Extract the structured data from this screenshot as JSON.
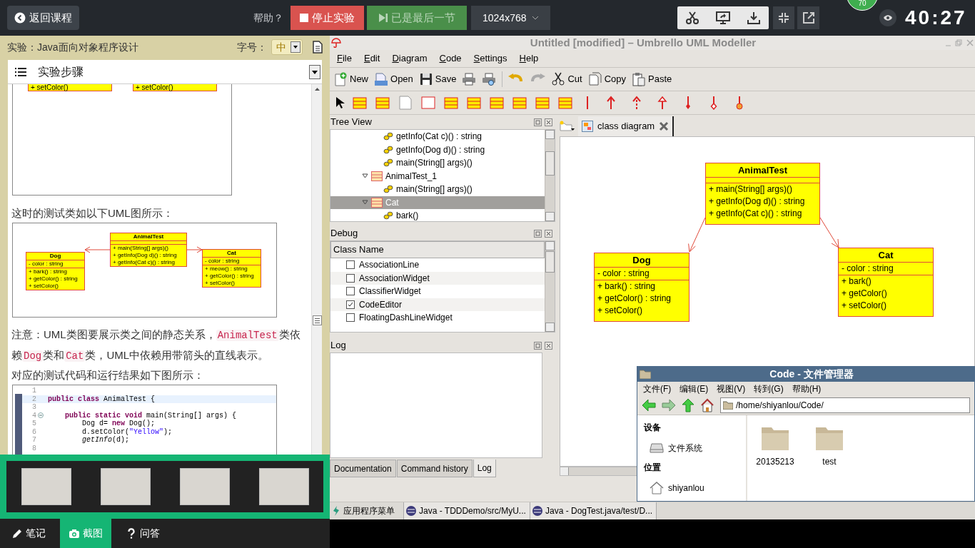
{
  "top_bar": {
    "back_button": "返回课程",
    "help": "帮助？",
    "stop_button": "停止实验",
    "last_button": "已是最后一节",
    "resolution": "1024x768",
    "score_badge": "70",
    "timer": "40:27"
  },
  "doc_panel": {
    "title": "实验：Java面向对象程序设计",
    "font_size_label": "字号：",
    "font_size": "中",
    "section": "实验步骤",
    "top_image": {
      "operations": [
        "+ setColor()",
        "+ setColor()"
      ]
    },
    "caption_1": "这时的测试类如以下UML图所示：",
    "uml_image": {
      "classes": [
        {
          "name": "Dog",
          "attributes": [
            "- color : string"
          ],
          "operations": [
            "+ bark() : string",
            "+ getColor() : string",
            "+ setColor()"
          ]
        },
        {
          "name": "AnimalTest",
          "operations": [
            "+ main(String[] args)()",
            "+ getInfo(Dog d)() : string",
            "+ getInfo(Cat c)() : string"
          ]
        },
        {
          "name": "Cat",
          "attributes": [
            "- color : string"
          ],
          "operations": [
            "+ meow() : string",
            "+ getColor() : string",
            "+ setColor()"
          ]
        }
      ]
    },
    "note": [
      {
        "kind": "text",
        "text": "注意：UML类图要展示类之间的静态关系，"
      },
      {
        "kind": "code",
        "text": "AnimalTest"
      },
      {
        "kind": "text",
        "text": "类依赖"
      },
      {
        "kind": "code",
        "text": "Dog"
      },
      {
        "kind": "text",
        "text": "类和"
      },
      {
        "kind": "code",
        "text": "Cat"
      },
      {
        "kind": "text",
        "text": "类，UML中依赖用带箭头的直线表示。"
      }
    ],
    "caption_2": "对应的测试代码和运行结果如下图所示：",
    "code_image": {
      "lines": [
        {
          "number": "1",
          "fold": false
        },
        {
          "number": "2",
          "fold": false,
          "parts": [
            {
              "kind": "keyword",
              "text": "public "
            },
            {
              "kind": "keyword",
              "text": "class "
            },
            {
              "kind": "plain",
              "text": "AnimalTest {"
            }
          ]
        },
        {
          "number": "3",
          "fold": false
        },
        {
          "number": "4",
          "fold": true,
          "parts": [
            {
              "kind": "keyword",
              "text": "    public "
            },
            {
              "kind": "keyword",
              "text": "static "
            },
            {
              "kind": "keyword",
              "text": "void "
            },
            {
              "kind": "plain",
              "text": "main(String[] args) {"
            }
          ]
        },
        {
          "number": "5",
          "fold": false,
          "parts": [
            {
              "kind": "plain",
              "text": "        Dog d= "
            },
            {
              "kind": "keyword",
              "text": "new"
            },
            {
              "kind": "plain",
              "text": " Dog();"
            }
          ]
        },
        {
          "number": "6",
          "fold": false,
          "parts": [
            {
              "kind": "plain",
              "text": "        d.setColor("
            },
            {
              "kind": "string",
              "text": "\"Yellow\""
            },
            {
              "kind": "plain",
              "text": ");"
            }
          ]
        },
        {
          "number": "7",
          "fold": false,
          "parts": [
            {
              "kind": "italic",
              "text": "        getInfo"
            },
            {
              "kind": "plain",
              "text": "(d);"
            }
          ]
        },
        {
          "number": "8",
          "fold": false
        }
      ]
    }
  },
  "thumbnails": [
    {
      "kind": "screenshot"
    },
    {
      "kind": "screenshot"
    },
    {
      "kind": "screenshot"
    },
    {
      "kind": "screenshot"
    }
  ],
  "bottom_tabs": [
    {
      "label": "笔记",
      "selected": false
    },
    {
      "label": "截图",
      "selected": true
    },
    {
      "label": "问答",
      "selected": false
    }
  ],
  "umbrello": {
    "title": "Untitled [modified] – Umbrello UML Modeller",
    "menu": [
      "File",
      "Edit",
      "Diagram",
      "Code",
      "Settings",
      "Help"
    ],
    "toolbar_buttons": [
      "New",
      "Open",
      "Save",
      "Cut",
      "Copy",
      "Paste"
    ],
    "tree_view": {
      "title": "Tree View",
      "items": [
        {
          "kind": "operation",
          "label": "getInfo(Cat c)() : string",
          "selected": false
        },
        {
          "kind": "operation",
          "label": "getInfo(Dog d)() : string",
          "selected": false
        },
        {
          "kind": "operation",
          "label": "main(String[] args)()",
          "selected": false
        },
        {
          "kind": "class",
          "label": "AnimalTest_1",
          "selected": false,
          "expanded": true,
          "children": [
            {
              "kind": "operation",
              "label": "main(String[] args)()",
              "selected": false
            }
          ]
        },
        {
          "kind": "class",
          "label": "Cat",
          "selected": true,
          "expanded": true,
          "children": [
            {
              "kind": "operation",
              "label": "bark()",
              "selected": false
            }
          ]
        }
      ]
    },
    "debug": {
      "title": "Debug",
      "column": "Class Name",
      "rows": [
        {
          "label": "AssociationLine",
          "checked": false
        },
        {
          "label": "AssociationWidget",
          "checked": false
        },
        {
          "label": "ClassifierWidget",
          "checked": false
        },
        {
          "label": "CodeEditor",
          "checked": true
        },
        {
          "label": "FloatingDashLineWidget",
          "checked": false
        }
      ]
    },
    "log": {
      "title": "Log"
    },
    "dock_tabs": [
      {
        "label": "Documentation",
        "selected": false
      },
      {
        "label": "Command history",
        "selected": false
      },
      {
        "label": "Log",
        "selected": true
      }
    ],
    "diagram_tab": {
      "label": "class diagram",
      "selected": true
    },
    "diagram": {
      "classes": [
        {
          "name": "AnimalTest",
          "operations": [
            "+ main(String[] args)()",
            "+ getInfo(Dog d)() : string",
            "+ getInfo(Cat c)() : string"
          ]
        },
        {
          "name": "Dog",
          "attributes": [
            "- color : string"
          ],
          "operations": [
            "+ bark() : string",
            "+ getColor() : string",
            "+ setColor()"
          ]
        },
        {
          "name": "Cat",
          "attributes": [
            "- color : string"
          ],
          "operations": [
            "+ bark()",
            "+ getColor()",
            "+ setColor()"
          ]
        }
      ]
    }
  },
  "file_manager": {
    "title": "Code - 文件管理器",
    "menu": [
      "文件(F)",
      "编辑(E)",
      "视图(V)",
      "转到(G)",
      "帮助(H)"
    ],
    "path": "/home/shiyanlou/Code/",
    "sections": [
      {
        "heading": "设备",
        "items": [
          {
            "kind": "drive",
            "label": "文件系统"
          }
        ]
      },
      {
        "heading": "位置",
        "items": [
          {
            "kind": "home",
            "label": "shiyanlou"
          }
        ]
      }
    ],
    "files": [
      "20135213",
      "test"
    ]
  },
  "taskbar": [
    {
      "kind": "menu",
      "label": "应用程序菜单"
    },
    {
      "kind": "window",
      "label": "Java - TDDDemo/src/MyU..."
    },
    {
      "kind": "window",
      "label": "Java - DogTest.java/test/D..."
    }
  ]
}
